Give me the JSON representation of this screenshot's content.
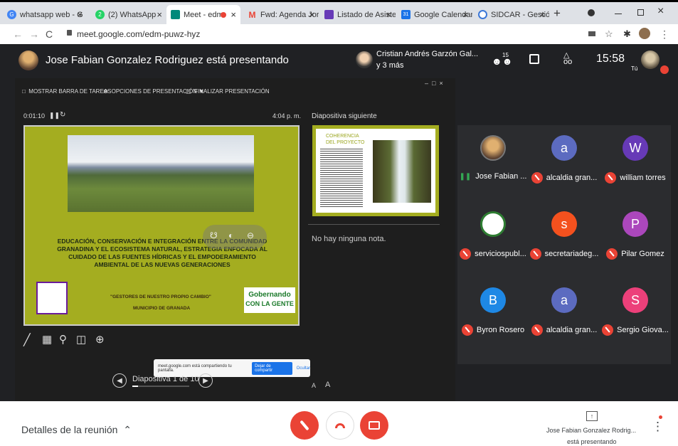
{
  "browser": {
    "tabs": [
      {
        "label": "whatsapp web - G",
        "fav_color": "#4285f4",
        "fav_glyph": "G",
        "active": false
      },
      {
        "label": "(2) WhatsApp",
        "fav_color": "#25d366",
        "fav_glyph": "2",
        "active": false
      },
      {
        "label": "Meet - edm-",
        "fav_color": "#00897b",
        "fav_glyph": "",
        "active": true
      },
      {
        "label": "Fwd: Agenda Jor",
        "fav_color": "#ea4335",
        "fav_glyph": "M",
        "active": false
      },
      {
        "label": "Listado de Asiste",
        "fav_color": "#673ab7",
        "fav_glyph": "",
        "active": false
      },
      {
        "label": "Google Calendar",
        "fav_color": "#1a73e8",
        "fav_glyph": "31",
        "active": false
      },
      {
        "label": "SIDCAR - Gestión",
        "fav_color": "#3c78d8",
        "fav_glyph": "",
        "active": false
      }
    ],
    "new_tab": "+",
    "url": "meet.google.com/edm-puwz-hyz"
  },
  "meet": {
    "presenter_title": "Jose Fabian Gonzalez Rodriguez está presentando",
    "viewer_name": "Cristian Andrés Garzón Gal...",
    "viewer_more": "y 3 más",
    "people_count": "15",
    "clock": "15:58",
    "self_label": "Tú",
    "toolbar": {
      "taskbar": "MOSTRAR BARRA DE TAREAS",
      "options": "OPCIONES DE PRESENTACIÓN ▼",
      "end": "FINALIZAR PRESENTACIÓN"
    },
    "timer": "0:01:10",
    "slide_time": "4:04 p. m.",
    "next_slide_label": "Diapositiva siguiente",
    "slide": {
      "title": "EDUCACIÓN, CONSERVACIÓN E INTEGRACIÓN ENTRE LA COMUNIDAD GRANADINA Y EL ECOSISTEMA NATURAL, ESTRATEGIA ENFOCADA AL CUIDADO DE LAS FUENTES HÍDRICAS Y EL EMPODERAMIENTO AMBIENTAL DE LAS NUEVAS GENERACIONES",
      "motto": "\"GESTORES DE NUESTRO PROPIO CAMBIO\"",
      "municipality": "MUNICIPIO DE GRANADA",
      "logo_text_1": "Gobernando",
      "logo_text_2": "CON LA GENTE"
    },
    "next_slide": {
      "title_1": "COHERENCIA",
      "title_2": "DEL PROYECTO"
    },
    "notes": "No hay ninguna nota.",
    "slide_counter": "Diapositiva 1 de 10",
    "font_small": "A",
    "font_large": "A",
    "share_banner": {
      "text": "meet.google.com está compartiendo tu pantalla.",
      "stop": "Dejar de compartir",
      "hide": "Ocultar"
    },
    "participants": [
      {
        "name": "Jose Fabian ...",
        "initial": "",
        "color": "#5f6368",
        "muted": false
      },
      {
        "name": "alcaldia gran...",
        "initial": "a",
        "color": "#5c6bc0",
        "muted": true
      },
      {
        "name": "william torres",
        "initial": "W",
        "color": "#673ab7",
        "muted": true
      },
      {
        "name": "serviciospubl...",
        "initial": "",
        "color": "#ffffff",
        "muted": true
      },
      {
        "name": "secretariadeg...",
        "initial": "s",
        "color": "#f4511e",
        "muted": true
      },
      {
        "name": "Pilar Gomez",
        "initial": "P",
        "color": "#ab47bc",
        "muted": true
      },
      {
        "name": "Byron Rosero",
        "initial": "B",
        "color": "#1e88e5",
        "muted": true
      },
      {
        "name": "alcaldia gran...",
        "initial": "a",
        "color": "#5c6bc0",
        "muted": true
      },
      {
        "name": "Sergio Giova...",
        "initial": "S",
        "color": "#ec407a",
        "muted": true
      }
    ]
  },
  "bottom": {
    "details": "Detalles de la reunión",
    "presenting_name": "Jose Fabian Gonzalez Rodrig...",
    "presenting_status": "está presentando"
  }
}
